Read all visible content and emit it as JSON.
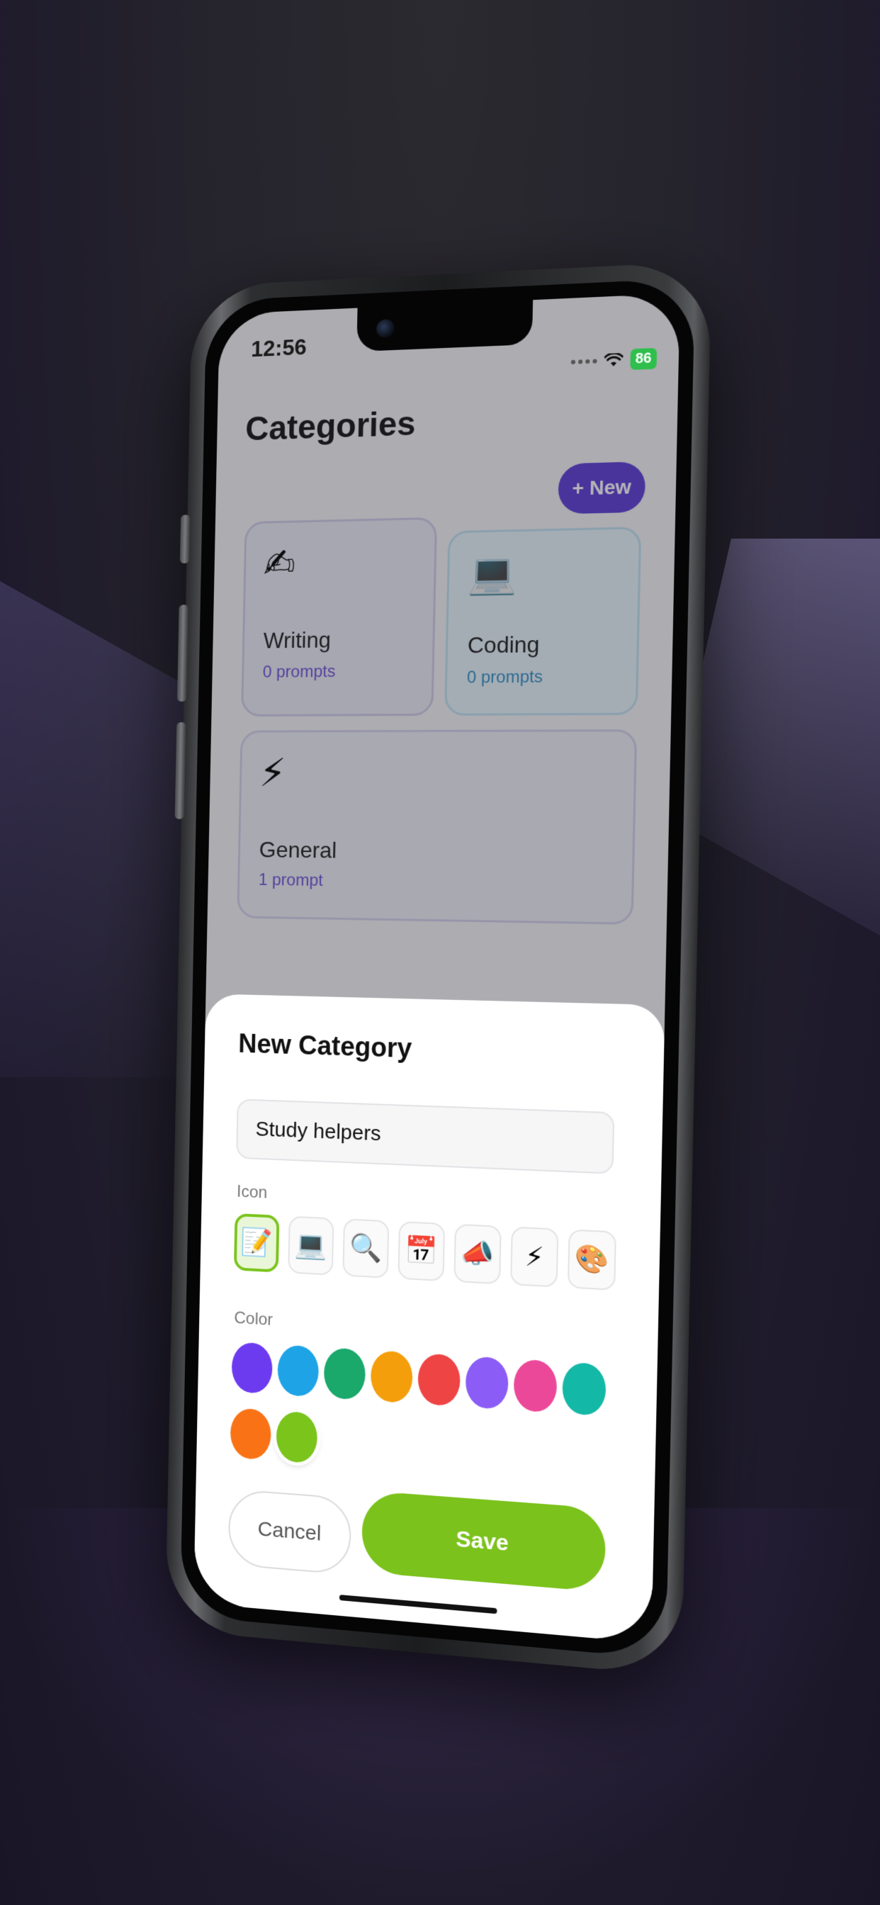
{
  "status_bar": {
    "time": "12:56",
    "battery": "86"
  },
  "page": {
    "title": "Categories",
    "new_button_label": "+ New",
    "categories": [
      {
        "icon": "✍",
        "name": "Writing",
        "count": "0 prompts"
      },
      {
        "icon": "💻",
        "name": "Coding",
        "count": "0 prompts"
      },
      {
        "icon": "⚡",
        "name": "General",
        "count": "1 prompt"
      }
    ]
  },
  "sheet": {
    "title": "New Category",
    "name_value": "Study helpers",
    "icon_label": "Icon",
    "color_label": "Color",
    "icons": [
      {
        "glyph": "📝",
        "name": "memo"
      },
      {
        "glyph": "💻",
        "name": "laptop"
      },
      {
        "glyph": "🔍",
        "name": "magnifier"
      },
      {
        "glyph": "📅",
        "name": "calendar"
      },
      {
        "glyph": "📣",
        "name": "megaphone"
      },
      {
        "glyph": "⚡",
        "name": "lightning"
      },
      {
        "glyph": "🎨",
        "name": "palette"
      }
    ],
    "selected_icon": "memo",
    "colors": [
      "#6c3bf0",
      "#1ea3e6",
      "#1aa86b",
      "#f59e0b",
      "#ef4444",
      "#8b5cf6",
      "#ec4899",
      "#14b8a6",
      "#f97316",
      "#7ac41c"
    ],
    "selected_color": "#7ac41c",
    "cancel_label": "Cancel",
    "save_label": "Save"
  }
}
